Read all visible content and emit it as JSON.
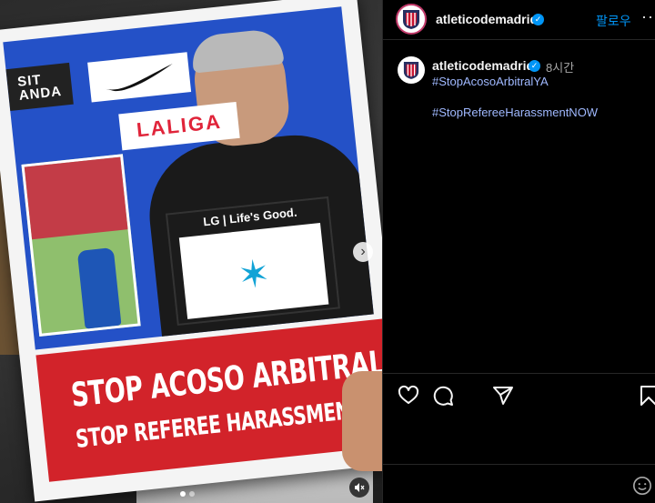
{
  "media": {
    "poster": {
      "sponsor_left": "SIT\nANDA",
      "sponsor_league": "LALIGA",
      "sign_text": "LG | Life's Good.",
      "banner_line1": "STOP ACOSO ARBITRAL YA",
      "banner_line2": "STOP REFEREE HARASSMENT NOW"
    },
    "carousel": {
      "total": 2,
      "current": 1
    },
    "icons": {
      "next": "chevron-right-icon",
      "mute": "speaker-muted-icon"
    }
  },
  "post": {
    "header": {
      "username": "atleticodemadrid",
      "verified": true,
      "follow_label": "팔로우",
      "more_label": "···"
    },
    "caption": {
      "username": "atleticodemadrid",
      "time": "8시간",
      "hashtags": [
        "#StopAcosoArbitralYA",
        "#StopRefereeHarassmentNOW"
      ]
    },
    "actions": [
      "heart-icon",
      "comment-icon",
      "share-icon",
      "bookmark-icon"
    ],
    "colors": {
      "link": "#0095f6",
      "hashtag": "#a0b9ff",
      "background": "#000000",
      "crest_red": "#c8102e",
      "crest_blue": "#272e61"
    }
  }
}
